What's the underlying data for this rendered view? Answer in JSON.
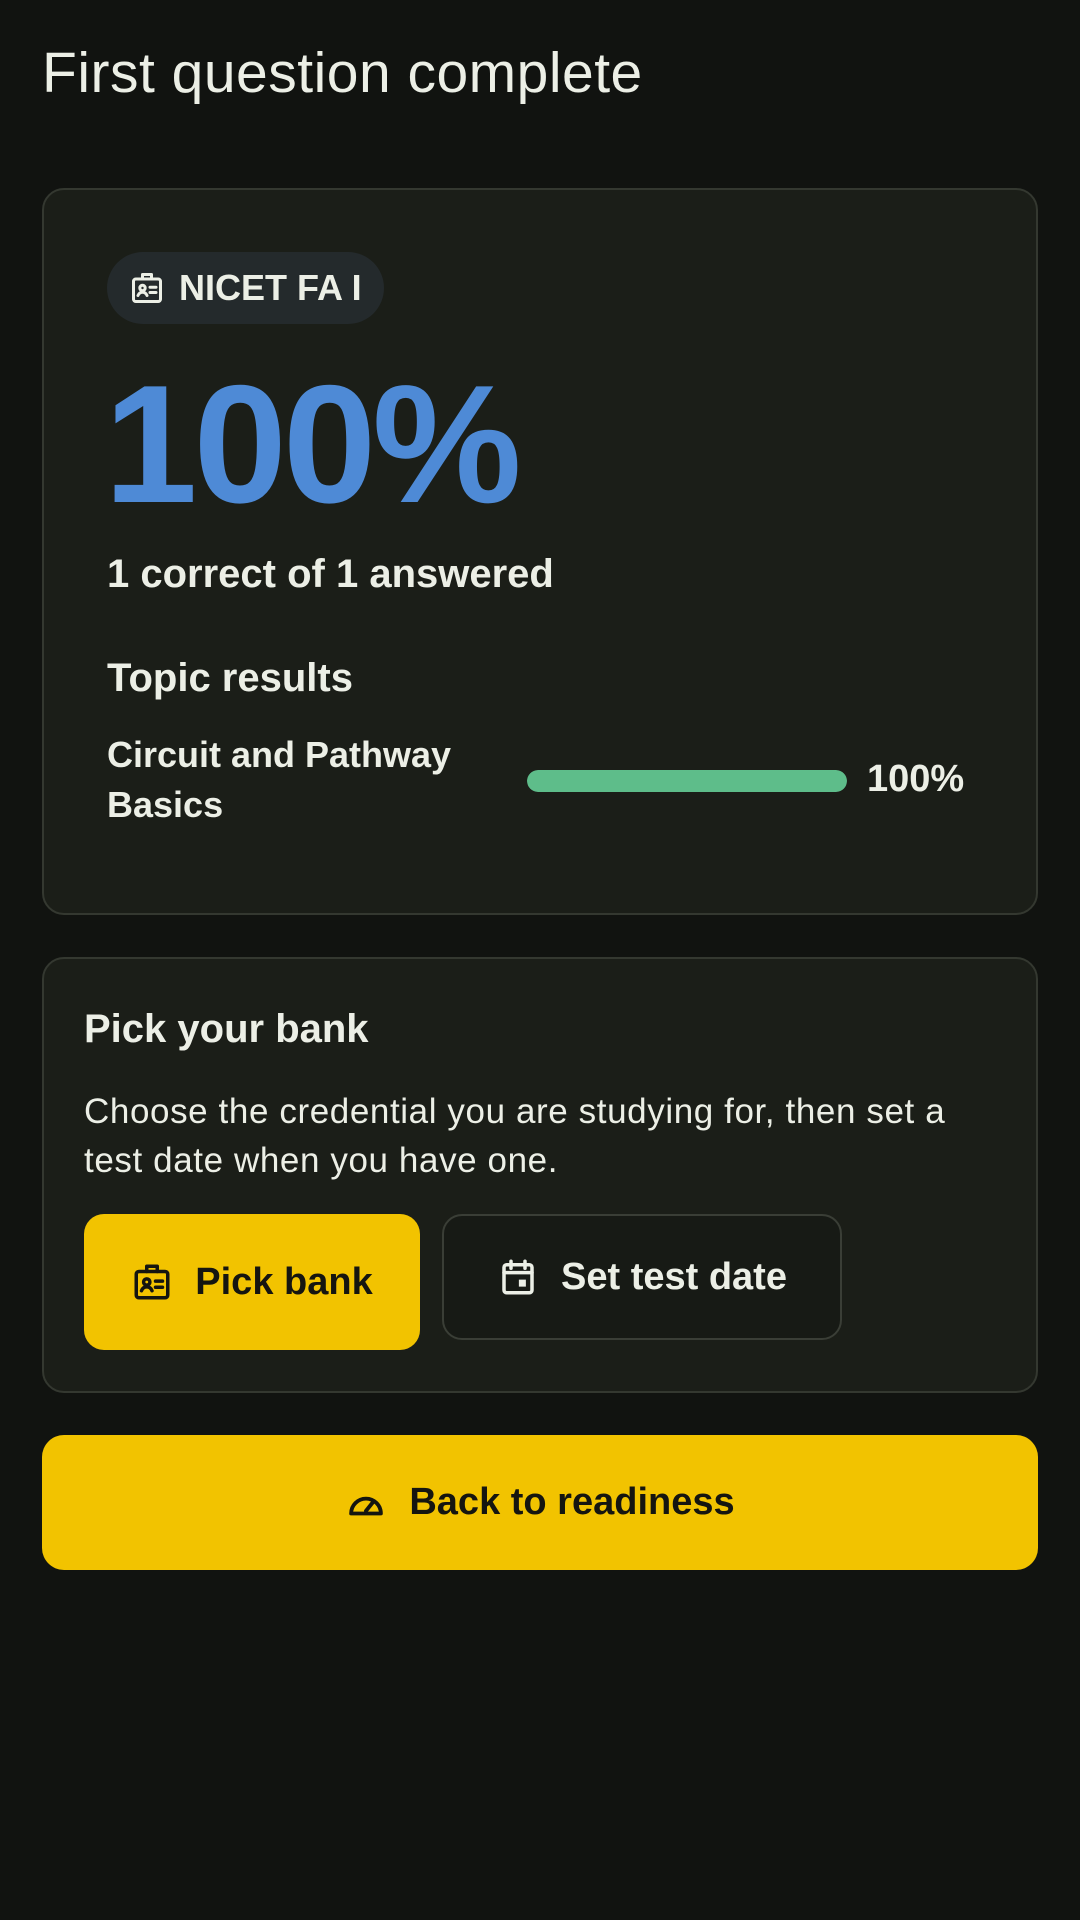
{
  "page": {
    "title": "First question complete"
  },
  "score_card": {
    "bank_chip": {
      "icon": "id-badge-icon",
      "label": "NICET FA I"
    },
    "score": "100%",
    "summary": "1 correct of 1 answered",
    "topic_heading": "Topic results",
    "topics": [
      {
        "name": "Circuit and Pathway Basics",
        "percent_label": "100%",
        "progress_percent": 100
      }
    ]
  },
  "bank_card": {
    "title": "Pick your bank",
    "description": "Choose the credential you are studying for, then set a test date when you have one.",
    "pick_bank_button": {
      "icon": "id-badge-icon",
      "label": "Pick bank"
    },
    "set_date_button": {
      "icon": "calendar-icon",
      "label": "Set test date"
    }
  },
  "back_button": {
    "icon": "speedometer-icon",
    "label": "Back to readiness"
  },
  "colors": {
    "background": "#111310",
    "card": "#1b1e18",
    "accent_yellow": "#f2c300",
    "score_blue": "#4e8ad6",
    "progress_green": "#5ebd8a"
  }
}
